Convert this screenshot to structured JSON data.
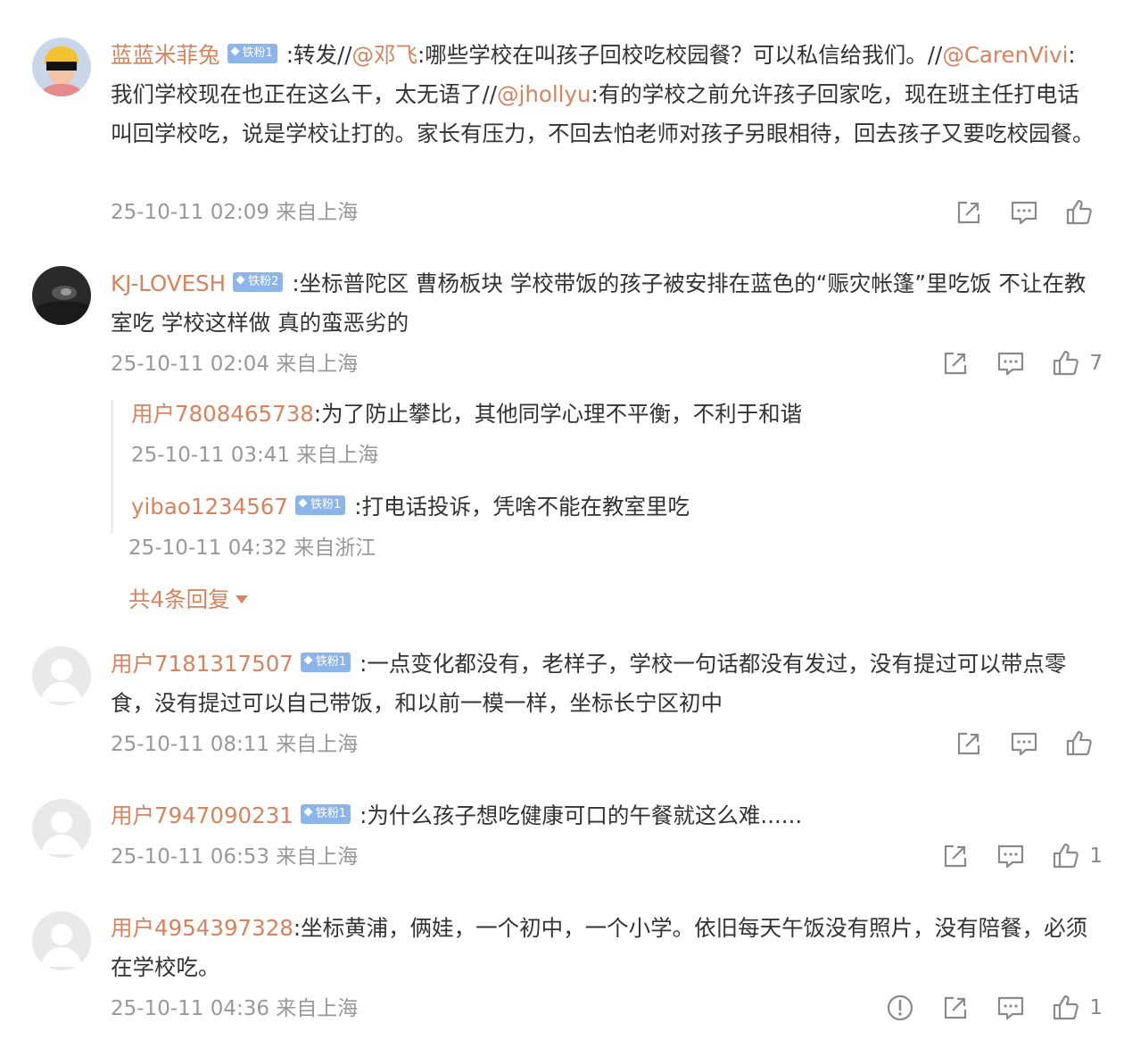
{
  "comments": [
    {
      "username": "蓝蓝米菲兔",
      "badge": "铁粉1",
      "parts": [
        ":转发//",
        "@邓飞",
        ":哪些学校在叫孩子回校吃校园餐？可以私信给我们。//",
        "@CarenVivi",
        ":我们学校现在也正在这么干，太无语了//",
        "@jhollyu",
        ":有的学校之前允许孩子回家吃，现在班主任打电话叫回学校吃，说是学校让打的。家长有压力，不回去怕老师对孩子另眼相待，回去孩子又要吃校园餐。"
      ],
      "meta": "25-10-11 02:09 来自上海",
      "likes": ""
    },
    {
      "username": "KJ-LOVESH",
      "badge": "铁粉2",
      "text": ":坐标普陀区 曹杨板块 学校带饭的孩子被安排在蓝色的“赈灾帐篷”里吃饭 不让在教室吃 学校这样做 真的蛮恶劣的",
      "meta": "25-10-11 02:04 来自上海",
      "likes": "7",
      "replies": [
        {
          "username": "用户7808465738",
          "text": ":为了防止攀比，其他同学心理不平衡，不利于和谐",
          "meta": "25-10-11 03:41 来自上海"
        },
        {
          "username": "yibao1234567",
          "badge": "铁粉1",
          "text": ":打电话投诉，凭啥不能在教室里吃",
          "meta": "25-10-11 04:32 来自浙江"
        }
      ],
      "more_replies": "共4条回复"
    },
    {
      "username": "用户7181317507",
      "badge": "铁粉1",
      "text": ":一点变化都没有，老样子，学校一句话都没有发过，没有提过可以带点零食，没有提过可以自己带饭，和以前一模一样，坐标长宁区初中",
      "meta": "25-10-11 08:11 来自上海",
      "likes": ""
    },
    {
      "username": "用户7947090231",
      "badge": "铁粉1",
      "text": ":为什么孩子想吃健康可口的午餐就这么难......",
      "meta": "25-10-11 06:53 来自上海",
      "likes": "1"
    },
    {
      "username": "用户4954397328",
      "text": ":坐标黄浦，俩娃，一个初中，一个小学。依旧每天午饭没有照片，没有陪餐，必须在学校吃。",
      "meta": "25-10-11 04:36 来自上海",
      "likes": "1"
    }
  ],
  "icons": [
    "share-icon",
    "comment-icon",
    "like-icon",
    "report-icon",
    "diamond-icon",
    "default-avatar-icon"
  ],
  "colors": {
    "username": "#d6835f",
    "meta": "#999999",
    "badge": "#8db5ea",
    "icon": "#888888"
  }
}
